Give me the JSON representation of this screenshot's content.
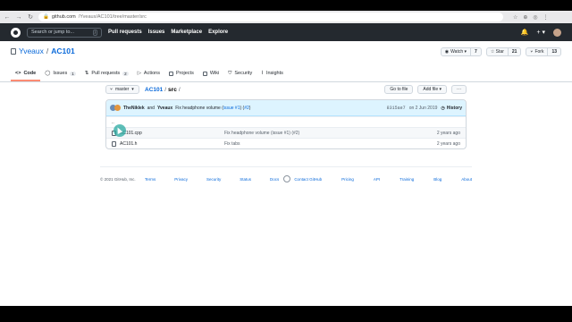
{
  "browser": {
    "back": "←",
    "forward": "→",
    "reload": "↻",
    "url_host": "github.com",
    "url_path": "/Yveaux/AC101/tree/master/src",
    "ext_icons": [
      "☆",
      "⊕",
      "◎",
      "⋮"
    ]
  },
  "header": {
    "search_placeholder": "Search or jump to...",
    "search_key": "/",
    "nav": [
      "Pull requests",
      "Issues",
      "Marketplace",
      "Explore"
    ],
    "bell": "🔔",
    "plus": "+ ▾"
  },
  "repo": {
    "owner": "Yveaux",
    "sep": "/",
    "name": "AC101",
    "watch_label": "Watch ▾",
    "watch_count": "7",
    "star_label": "☆ Star",
    "star_count": "21",
    "fork_label": "Fork",
    "fork_count": "13",
    "tabs": [
      {
        "label": "Code",
        "badge": ""
      },
      {
        "label": "Issues",
        "badge": "1"
      },
      {
        "label": "Pull requests",
        "badge": "2"
      },
      {
        "label": "Actions",
        "badge": ""
      },
      {
        "label": "Projects",
        "badge": ""
      },
      {
        "label": "Wiki",
        "badge": ""
      },
      {
        "label": "Security",
        "badge": ""
      },
      {
        "label": "Insights",
        "badge": ""
      }
    ]
  },
  "filenav": {
    "branch": "master",
    "crumb_repo": "AC101",
    "crumb_sep": "/",
    "crumb_dir": "src",
    "crumb_trailing": "/",
    "goto_file": "Go to file",
    "add_file": "Add file ▾",
    "more": "···"
  },
  "commit": {
    "author1": "TheNiklek",
    "and": "and",
    "author2": "Yveaux",
    "message_pre": "Fix headphone volume (",
    "message_issue": "issue #1",
    "message_mid": ") (",
    "message_pr": "#2",
    "message_post": ")",
    "sha": "8315ae7",
    "date": "on 2 Jun 2019",
    "history": "History"
  },
  "files": [
    {
      "name": "..",
      "message": "",
      "age": ""
    },
    {
      "name": "AC101.cpp",
      "message": "Fix headphone volume (issue #1) (#2)",
      "age": "2 years ago"
    },
    {
      "name": "AC101.h",
      "message": "Fix tabs",
      "age": "2 years ago"
    }
  ],
  "footer": {
    "copyright": "© 2021 GitHub, Inc.",
    "left_links": [
      "Terms",
      "Privacy",
      "Security",
      "Status",
      "Docs"
    ],
    "right_links": [
      "Contact GitHub",
      "Pricing",
      "API",
      "Training",
      "Blog",
      "About"
    ]
  }
}
